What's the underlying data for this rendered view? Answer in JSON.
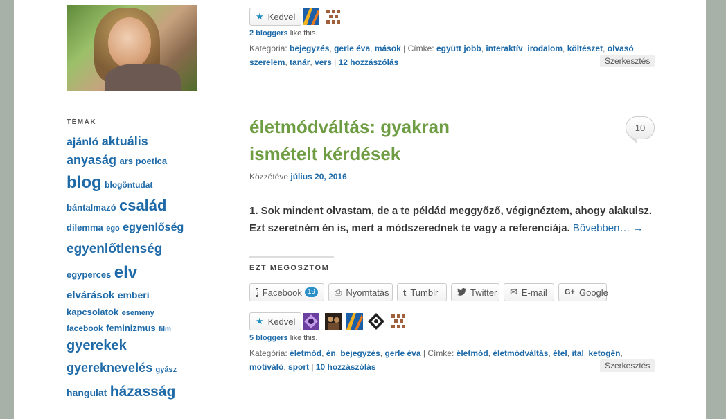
{
  "sidebar": {
    "themes_title": "TÉMÁK",
    "tags": [
      [
        {
          "t": "ajánló",
          "s": 16
        },
        {
          "t": "aktuális",
          "s": 18
        }
      ],
      [
        {
          "t": "anyaság",
          "s": 18
        },
        {
          "t": "ars poetica",
          "s": 13
        }
      ],
      [
        {
          "t": "blog",
          "s": 24
        },
        {
          "t": "blogöntudat",
          "s": 12
        }
      ],
      [
        {
          "t": "bántalmazó",
          "s": 13
        },
        {
          "t": "család",
          "s": 22
        }
      ],
      [
        {
          "t": "dilemma",
          "s": 13
        },
        {
          "t": "ego",
          "s": 11
        },
        {
          "t": "egyenlőség",
          "s": 16
        }
      ],
      [
        {
          "t": "egyenlőtlenség",
          "s": 19
        }
      ],
      [
        {
          "t": "egyperces",
          "s": 13
        },
        {
          "t": "elv",
          "s": 24
        }
      ],
      [
        {
          "t": "elvárások",
          "s": 15
        },
        {
          "t": "emberi",
          "s": 14
        }
      ],
      [
        {
          "t": "kapcsolatok",
          "s": 13
        },
        {
          "t": "esemény",
          "s": 11
        }
      ],
      [
        {
          "t": "facebook",
          "s": 12
        },
        {
          "t": "feminizmus",
          "s": 13
        },
        {
          "t": "film",
          "s": 10
        }
      ],
      [
        {
          "t": "gyerekek",
          "s": 20
        }
      ],
      [
        {
          "t": "gyereknevelés",
          "s": 18
        },
        {
          "t": "gyász",
          "s": 11
        }
      ],
      [
        {
          "t": "hangulat",
          "s": 14
        },
        {
          "t": "házasság",
          "s": 21
        }
      ]
    ]
  },
  "post1": {
    "like_label": "Kedvel",
    "bloggers": "2 bloggers",
    "like_this": "like this.",
    "meta_line1_prefix": "Kategória:",
    "categories": [
      "bejegyzés",
      "gerle éva",
      "mások"
    ],
    "tags_prefix": "Címke:",
    "tags_line1": [
      "együtt jobb",
      "interaktív",
      "irodalom",
      "költészet",
      "olvasó"
    ],
    "tags_line2": [
      "szerelem",
      "tanár",
      "vers"
    ],
    "comments": "12 hozzászólás",
    "edit": "Szerkesztés"
  },
  "post2": {
    "title": "életmódváltás: gyakran ismételt kérdések",
    "comment_count": "10",
    "posted_prefix": "Közzétéve",
    "date": "július 20, 2016",
    "excerpt": "1. Sok mindent olvastam, de a te példád meggyőző, végignéztem, ahogy alakulsz. Ezt szeretném én is, mert a módszerednek te vagy a referenciája.",
    "more": "Bővebben… →",
    "share_title": "EZT MEGOSZTOM",
    "share_buttons": [
      {
        "label": "Facebook",
        "icon": "f",
        "badge": "19"
      },
      {
        "label": "Nyomtatás",
        "icon": "⎙"
      },
      {
        "label": "Tumblr",
        "icon": "t"
      },
      {
        "label": "Twitter",
        "icon": "🐦"
      },
      {
        "label": "E-mail",
        "icon": "✉"
      },
      {
        "label": "Google",
        "icon": "G+"
      }
    ],
    "like_label": "Kedvel",
    "bloggers": "5 bloggers",
    "like_this": "like this.",
    "meta_prefix": "Kategória:",
    "categories": [
      "életmód",
      "én",
      "bejegyzés",
      "gerle éva"
    ],
    "tags_prefix": "Címke:",
    "tags_line1": [
      "életmód",
      "életmódváltás",
      "étel",
      "ital",
      "ketogén"
    ],
    "tags_line2": [
      "motiváló",
      "sport"
    ],
    "comments": "10 hozzászólás",
    "edit": "Szerkesztés"
  }
}
